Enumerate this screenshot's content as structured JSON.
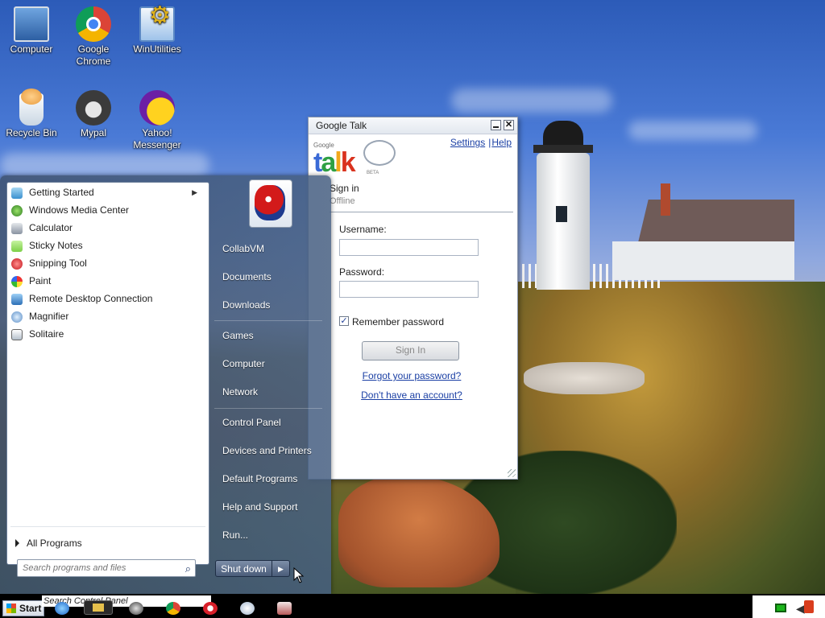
{
  "desktop": {
    "icons": [
      {
        "label": "Computer",
        "icon": "computer-icon"
      },
      {
        "label": "Google Chrome",
        "icon": "chrome-icon"
      },
      {
        "label": "WinUtilities",
        "icon": "winutilities-icon"
      },
      {
        "label": "Recycle Bin",
        "icon": "recycle-bin-icon"
      },
      {
        "label": "Mypal",
        "icon": "mypal-icon"
      },
      {
        "label": "Yahoo! Messenger",
        "icon": "yahoo-messenger-icon"
      }
    ]
  },
  "gtalk": {
    "title": "Google Talk",
    "logo_small": "Google",
    "logo_talk": "talk",
    "logo_beta": "BETA",
    "links": {
      "settings": "Settings",
      "separator": "|",
      "help": "Help"
    },
    "signin_heading": "Sign in",
    "status": "Offline",
    "username_label": "Username:",
    "username_value": "",
    "password_label": "Password:",
    "password_value": "",
    "remember_label": "Remember password",
    "remember_checked": true,
    "signin_button": "Sign In",
    "forgot_link": "Forgot your password?",
    "no_account_link": "Don't have an account?"
  },
  "startmenu": {
    "programs": [
      {
        "label": "Getting Started",
        "icon": "getting-started-icon",
        "has_submenu": true
      },
      {
        "label": "Windows Media Center",
        "icon": "media-center-icon"
      },
      {
        "label": "Calculator",
        "icon": "calculator-icon"
      },
      {
        "label": "Sticky Notes",
        "icon": "sticky-notes-icon"
      },
      {
        "label": "Snipping Tool",
        "icon": "snipping-tool-icon"
      },
      {
        "label": "Paint",
        "icon": "paint-icon"
      },
      {
        "label": "Remote Desktop Connection",
        "icon": "remote-desktop-icon"
      },
      {
        "label": "Magnifier",
        "icon": "magnifier-icon"
      },
      {
        "label": "Solitaire",
        "icon": "solitaire-icon"
      }
    ],
    "all_programs": "All Programs",
    "search_placeholder": "Search programs and files",
    "right_items": {
      "user": "CollabVM",
      "documents": "Documents",
      "downloads": "Downloads",
      "games": "Games",
      "computer": "Computer",
      "network": "Network",
      "control_panel": "Control Panel",
      "devices": "Devices and Printers",
      "default_programs": "Default Programs",
      "help": "Help and Support",
      "run": "Run..."
    },
    "shutdown": "Shut down"
  },
  "taskbar": {
    "start_label": "Start",
    "search_text": "Search Control Panel",
    "pinned": [
      "internet-explorer-icon",
      "windows-explorer-icon",
      "mypal-icon",
      "chrome-icon",
      "opera-icon",
      "google-talk-icon",
      "collabvm-icon"
    ]
  }
}
